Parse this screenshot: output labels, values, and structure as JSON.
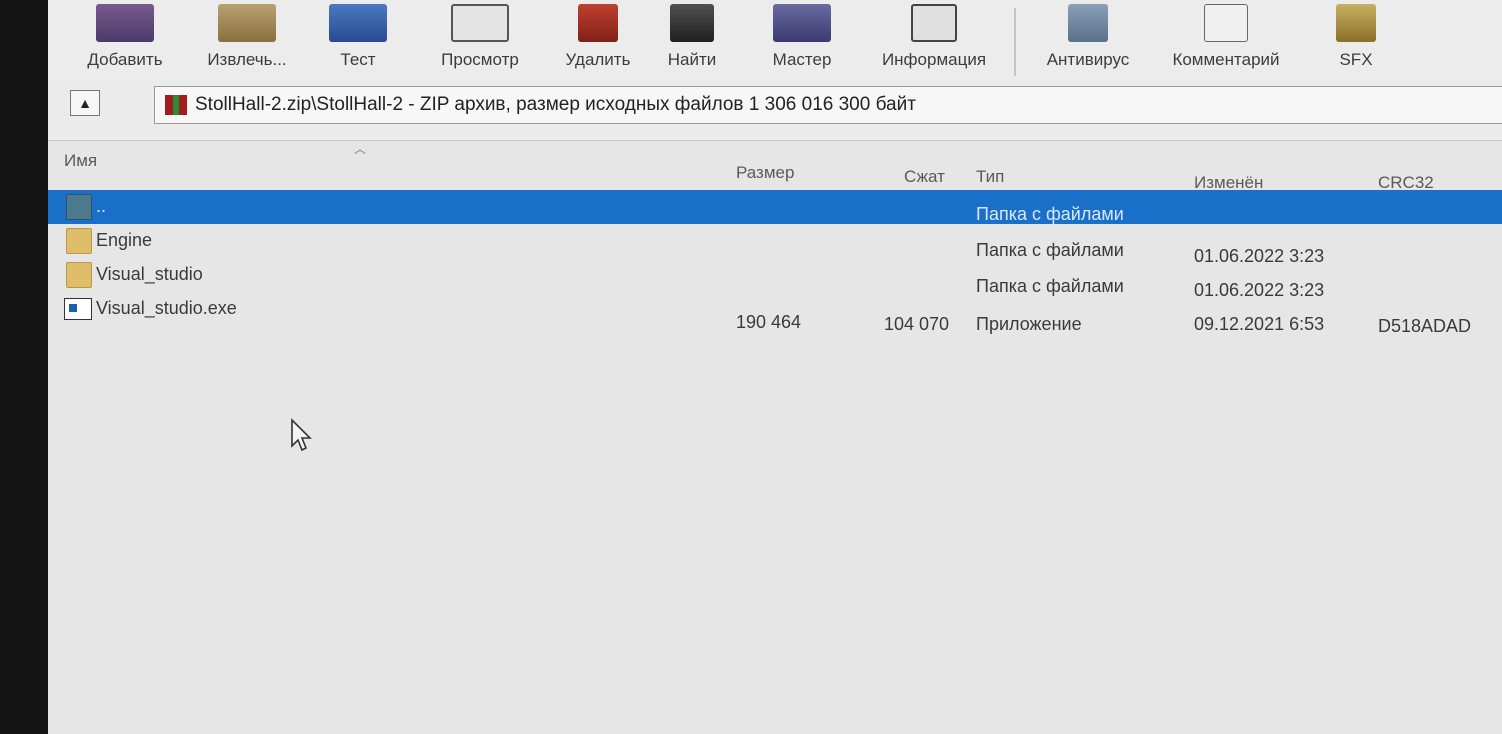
{
  "toolbar": {
    "buttons": [
      {
        "label": "Добавить",
        "icon": "add-archive-icon"
      },
      {
        "label": "Извлечь...",
        "icon": "extract-icon"
      },
      {
        "label": "Тест",
        "icon": "test-icon"
      },
      {
        "label": "Просмотр",
        "icon": "view-icon"
      },
      {
        "label": "Удалить",
        "icon": "delete-icon"
      },
      {
        "label": "Найти",
        "icon": "find-icon"
      },
      {
        "label": "Мастер",
        "icon": "wizard-icon"
      },
      {
        "label": "Информация",
        "icon": "info-icon"
      },
      {
        "label": "Антивирус",
        "icon": "antivirus-icon"
      },
      {
        "label": "Комментарий",
        "icon": "comment-icon"
      },
      {
        "label": "SFX",
        "icon": "sfx-icon"
      }
    ]
  },
  "address": {
    "text": "StollHall-2.zip\\StollHall-2 - ZIP архив, размер исходных файлов 1 306 016 300 байт"
  },
  "columns": {
    "name": "Имя",
    "size": "Размер",
    "packed": "Сжат",
    "type": "Тип",
    "modified": "Изменён",
    "crc": "CRC32"
  },
  "rows": [
    {
      "name": "..",
      "size": "",
      "packed": "",
      "type": "Папка с файлами",
      "modified": "",
      "crc": "",
      "icon": "up-folder-icon",
      "selected": true
    },
    {
      "name": "Engine",
      "size": "",
      "packed": "",
      "type": "Папка с файлами",
      "modified": "01.06.2022 3:23",
      "crc": "",
      "icon": "folder-icon",
      "selected": false
    },
    {
      "name": "Visual_studio",
      "size": "",
      "packed": "",
      "type": "Папка с файлами",
      "modified": "01.06.2022 3:23",
      "crc": "",
      "icon": "folder-icon",
      "selected": false
    },
    {
      "name": "Visual_studio.exe",
      "size": "190 464",
      "packed": "104 070",
      "type": "Приложение",
      "modified": "09.12.2021 6:53",
      "crc": "D518ADAD",
      "icon": "exe-icon",
      "selected": false
    }
  ],
  "colors": {
    "selection": "#1a6fc8",
    "window_bg": "#e6e6e6"
  }
}
